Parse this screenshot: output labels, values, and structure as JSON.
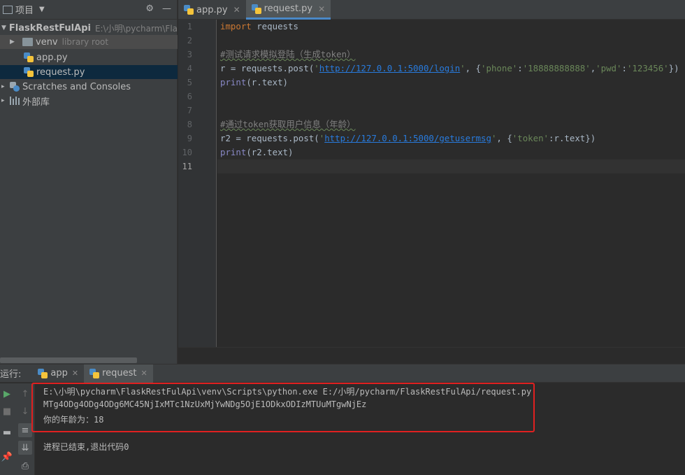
{
  "project_panel": {
    "title": "项目",
    "tree": [
      {
        "label": "FlaskRestFulApi",
        "path": "E:\\小明\\pycharm\\Flas"
      },
      {
        "label": "venv",
        "note": "library root"
      },
      {
        "label": "app.py"
      },
      {
        "label": "request.py"
      },
      {
        "label": "Scratches and Consoles"
      },
      {
        "label": "外部库"
      }
    ]
  },
  "editor": {
    "tabs": [
      {
        "label": "app.py"
      },
      {
        "label": "request.py"
      }
    ],
    "line_numbers": [
      "1",
      "2",
      "3",
      "4",
      "5",
      "6",
      "7",
      "8",
      "9",
      "10",
      "11"
    ],
    "code": {
      "l1_kw": "import",
      "l1_rest": " requests",
      "l3": "#测试请求模拟登陆（生成token）",
      "l4_a": "r = requests.post(",
      "l4_q1": "'",
      "l4_url": "http://127.0.0.1:5000/login",
      "l4_q2": "'",
      "l4_b": ", {",
      "l4_s1": "'phone'",
      "l4_c1": ":",
      "l4_s2": "'18888888888'",
      "l4_c2": ",",
      "l4_s3": "'pwd'",
      "l4_c3": ":",
      "l4_s4": "'123456'",
      "l4_end": "})",
      "l5_fn": "print",
      "l5_rest": "(r.text)",
      "l8": "#通过token获取用户信息（年龄）",
      "l9_a": "r2 = requests.post(",
      "l9_q1": "'",
      "l9_url": "http://127.0.0.1:5000/getusermsg",
      "l9_q2": "'",
      "l9_b": ", {",
      "l9_s1": "'token'",
      "l9_c1": ":",
      "l9_end": "r.text})",
      "l10_fn": "print",
      "l10_rest": "(r2.text)"
    }
  },
  "run_panel": {
    "label": "运行:",
    "tabs": [
      {
        "label": "app"
      },
      {
        "label": "request"
      }
    ],
    "output": [
      "E:\\小明\\pycharm\\FlaskRestFulApi\\venv\\Scripts\\python.exe E:/小明/pycharm/FlaskRestFulApi/request.py",
      "MTg4ODg4ODg4ODg6MC45NjIxMTc1NzUxMjYwNDg5OjE1ODkxODIzMTUuMTgwNjEz",
      "你的年龄为：18",
      "进程已结束,退出代码0"
    ]
  },
  "colors": {
    "highlight_box": "#e02020",
    "selection": "#0d293e",
    "tab_underline": "#4a88c7"
  }
}
